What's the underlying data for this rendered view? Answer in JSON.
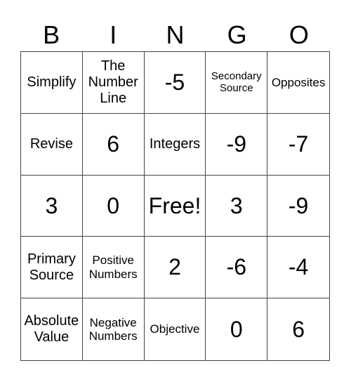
{
  "header": {
    "letters": [
      "B",
      "I",
      "N",
      "G",
      "O"
    ]
  },
  "cells": [
    {
      "text": "Simplify",
      "size": "md"
    },
    {
      "text": "The Number Line",
      "size": "md"
    },
    {
      "text": "-5",
      "size": "num"
    },
    {
      "text": "Secondary Source",
      "size": "xs"
    },
    {
      "text": "Opposites",
      "size": "sm"
    },
    {
      "text": "Revise",
      "size": "md"
    },
    {
      "text": "6",
      "size": "num"
    },
    {
      "text": "Integers",
      "size": "md"
    },
    {
      "text": "-9",
      "size": "num"
    },
    {
      "text": "-7",
      "size": "num"
    },
    {
      "text": "3",
      "size": "num"
    },
    {
      "text": "0",
      "size": "num"
    },
    {
      "text": "Free!",
      "size": "num"
    },
    {
      "text": "3",
      "size": "num"
    },
    {
      "text": "-9",
      "size": "num"
    },
    {
      "text": "Primary Source",
      "size": "md"
    },
    {
      "text": "Positive Numbers",
      "size": "sm"
    },
    {
      "text": "2",
      "size": "num"
    },
    {
      "text": "-6",
      "size": "num"
    },
    {
      "text": "-4",
      "size": "num"
    },
    {
      "text": "Absolute Value",
      "size": "md"
    },
    {
      "text": "Negative Numbers",
      "size": "sm"
    },
    {
      "text": "Objective",
      "size": "sm"
    },
    {
      "text": "0",
      "size": "num"
    },
    {
      "text": "6",
      "size": "num"
    }
  ]
}
